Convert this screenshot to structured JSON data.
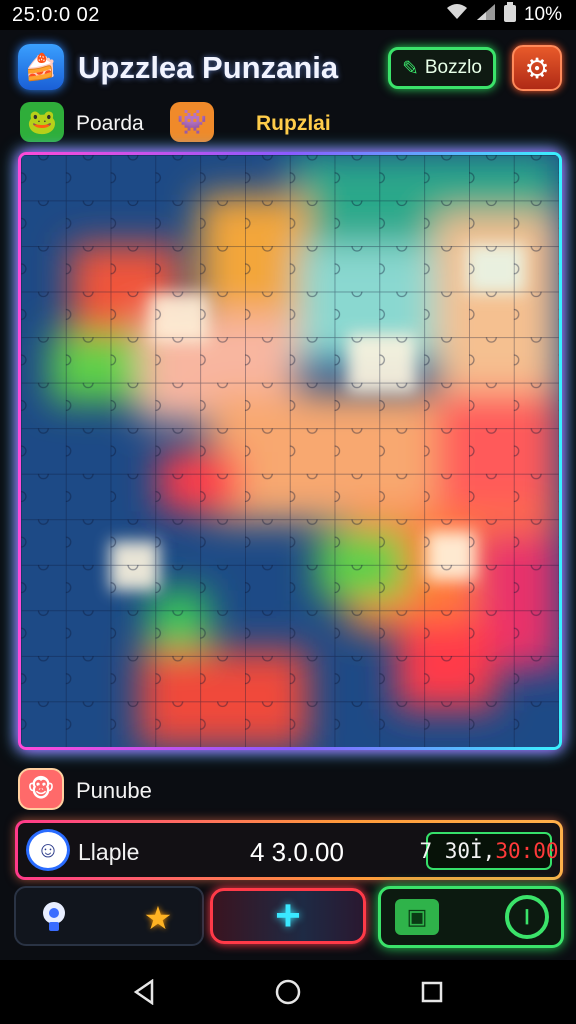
{
  "status_bar": {
    "time": "25:0:0 02",
    "battery": "10%",
    "icons": [
      "wifi-icon",
      "signal-icon",
      "battery-icon"
    ]
  },
  "header": {
    "title": "Upzzlea Punzania",
    "button_label": "Bozzlo",
    "button_icon": "puzzle-piece-icon",
    "settings_icon": "gear-icon"
  },
  "players": [
    {
      "name": "Poarda",
      "avatar": "frog-avatar"
    },
    {
      "name": "Rupzlai",
      "avatar": "monster-avatar"
    }
  ],
  "board": {
    "colors": {
      "border_left": "#ff4ad8",
      "border_right": "#3af2ff",
      "base": "#1a3f78"
    }
  },
  "sub_player": {
    "name": "Punube",
    "avatar": "monkey-avatar"
  },
  "score": {
    "name": "Llaple",
    "value": "4 3.0.00",
    "timer_part_a": "7 30İ,",
    "timer_part_b": "30:00"
  },
  "toolbar": {
    "add_label": "+",
    "icons": [
      "bulb-icon",
      "star-icon",
      "add-icon",
      "chat-icon",
      "power-icon"
    ]
  },
  "colors": {
    "accent_green": "#3be36a",
    "accent_red": "#ff3a48",
    "accent_cyan": "#3ae8ff"
  }
}
